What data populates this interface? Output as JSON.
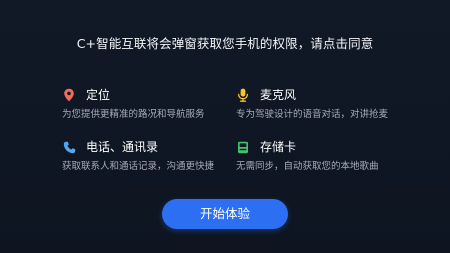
{
  "dialog": {
    "title": "C+智能互联将会弹窗获取您手机的权限，请点击同意"
  },
  "permissions": [
    {
      "icon": "location-pin-icon",
      "name": "定位",
      "description": "为您提供更精准的路况和导航服务",
      "color": "#f26a5b"
    },
    {
      "icon": "microphone-icon",
      "name": "麦克风",
      "description": "专为驾驶设计的语音对话，对讲抢麦",
      "color": "#f3c62a"
    },
    {
      "icon": "phone-icon",
      "name": "电话、通讯录",
      "description": "获取联系人和通话记录，沟通更快捷",
      "color": "#4fa8f5"
    },
    {
      "icon": "storage-card-icon",
      "name": "存储卡",
      "description": "无需同步，自动获取您的本地歌曲",
      "color": "#47c26b"
    }
  ],
  "start_button": {
    "label": "开始体验",
    "color": "#2d6ff3"
  }
}
